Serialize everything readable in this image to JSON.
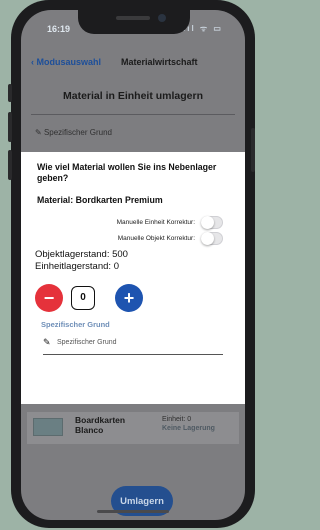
{
  "status": {
    "time": "16:19",
    "icons": "ııl ᯤ ▭"
  },
  "nav": {
    "back_label": "Modusauswahl",
    "title": "Materialwirtschaft"
  },
  "page": {
    "title": "Material in Einheit umlagern",
    "reason_placeholder": "Spezifischer Grund"
  },
  "modal": {
    "question": "Wie viel Material wollen Sie ins Nebenlager geben?",
    "material": "Material: Bordkarten Premium",
    "toggles": [
      {
        "label": "Manuelle Einheit Korrektur:",
        "on": false
      },
      {
        "label": "Manuelle Objekt Korrektur:",
        "on": false
      }
    ],
    "objekt_stock": "Objektlagerstand: 500",
    "einheit_stock": "Einheitlagerstand: 0",
    "minus": "−",
    "quantity": "0",
    "plus": "+",
    "reason_label": "Spezifischer Grund",
    "reason_placeholder": "Spezifischer Grund"
  },
  "list_item": {
    "name": "Boardkarten Blanco",
    "unit": "Einheit: 0",
    "storage": "Keine Lagerung"
  },
  "action": {
    "umlagern_label": "Umlagern"
  },
  "colors": {
    "accent": "#1e54b0",
    "danger": "#e5323b",
    "primary_button": "#244f8f"
  }
}
